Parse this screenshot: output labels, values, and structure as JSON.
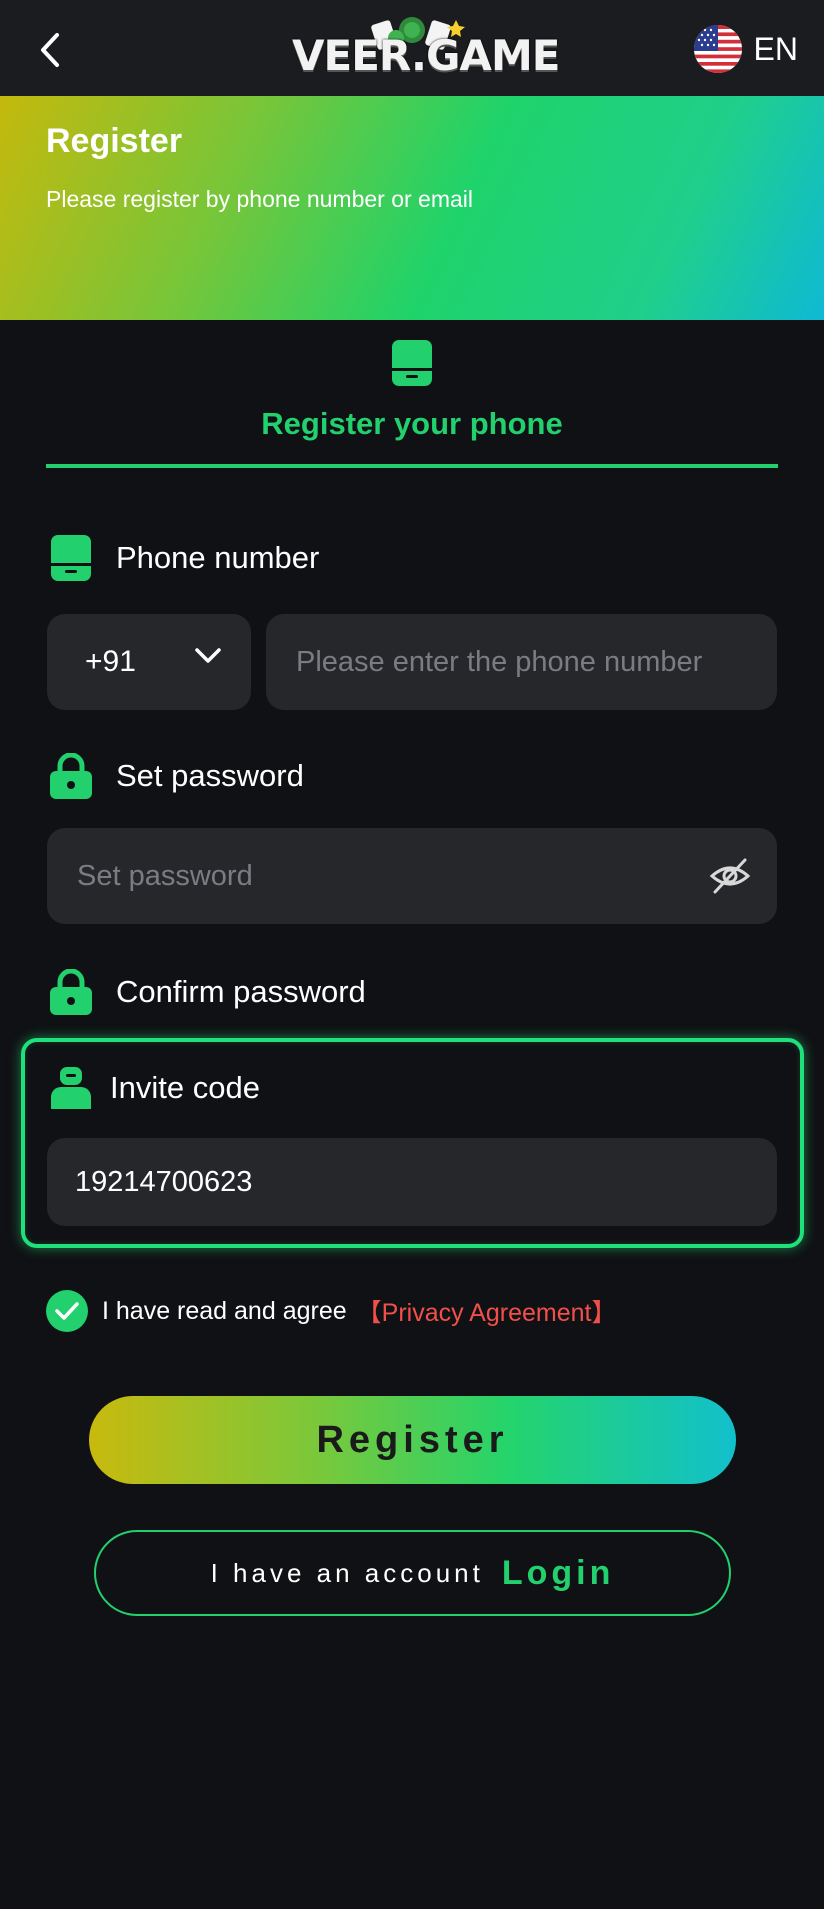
{
  "header": {
    "logo_text": "VEER.GAME",
    "language": "EN"
  },
  "hero": {
    "title": "Register",
    "subtitle": "Please register by phone number or email"
  },
  "tab": {
    "label": "Register your phone"
  },
  "form": {
    "phone_label": "Phone number",
    "country_code": "+91",
    "phone_placeholder": "Please enter the phone number",
    "password_label": "Set password",
    "password_placeholder": "Set password",
    "confirm_label": "Confirm password",
    "invite_label": "Invite code",
    "invite_value": "19214700623"
  },
  "agreement": {
    "text": "I have read and agree",
    "link": "【Privacy Agreement】",
    "checked": true
  },
  "actions": {
    "register_label": "Register",
    "have_account": "I have an account",
    "login_label": "Login"
  },
  "colors": {
    "accent": "#22d06e",
    "background": "#101114",
    "input_bg": "#26272b",
    "link_red": "#f0504a"
  }
}
